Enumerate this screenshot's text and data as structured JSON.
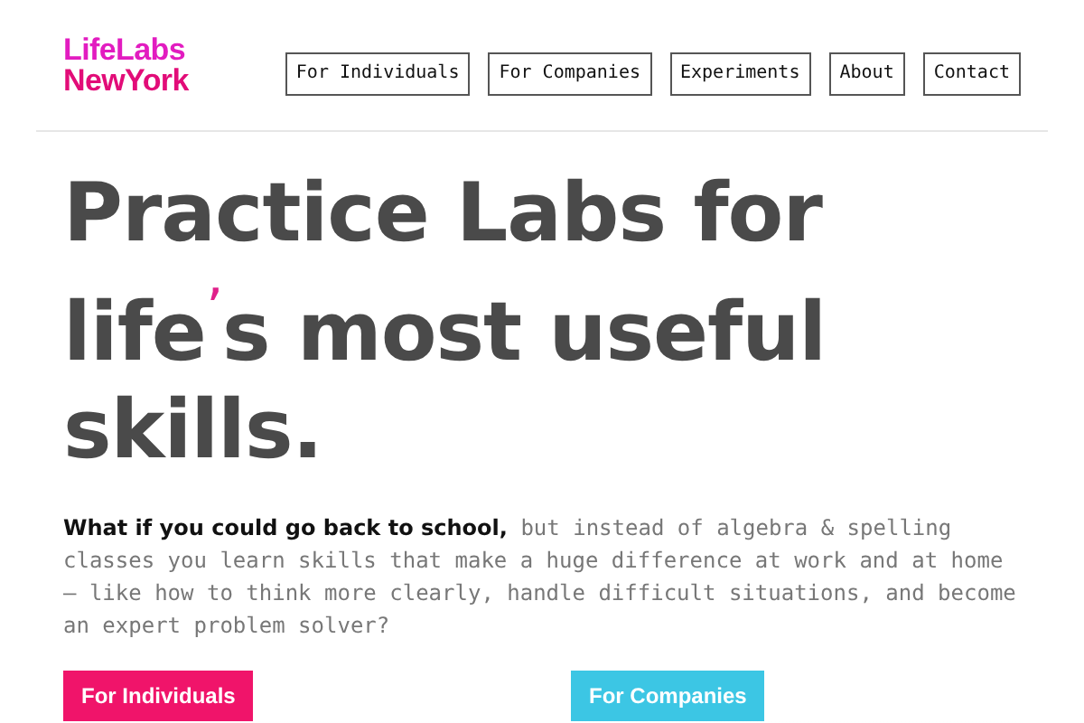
{
  "logo": {
    "lines": [
      "LifeLabs",
      "NewYork"
    ]
  },
  "nav": [
    "For Individuals",
    "For Companies",
    "Experiments",
    "About",
    "Contact"
  ],
  "headline": {
    "before": "Practice Labs for life",
    "mark": "’",
    "after": "s most useful skills."
  },
  "intro": "**What if you could go back to school,** but instead of algebra & spelling classes you learn skills that make a huge difference at work and at home — like how to think more clearly, handle difficult situations, and become an expert problem solver?",
  "cards": [
    {
      "label": "For Individuals",
      "color": "#f0146a"
    },
    {
      "label": "For Companies",
      "color": "#3cc6e4"
    }
  ]
}
